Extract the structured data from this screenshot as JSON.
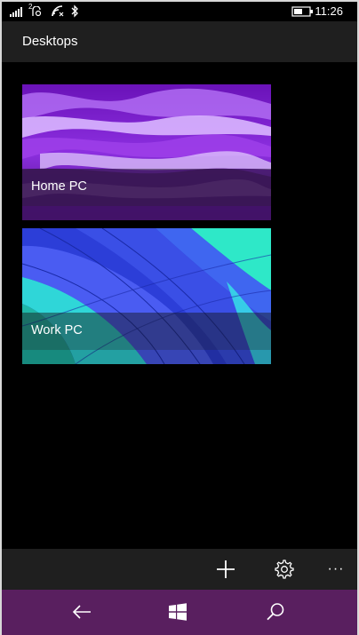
{
  "status_bar": {
    "time": "11:26",
    "sim_badge": "2",
    "icons": [
      "signal-icon",
      "sim2-icon",
      "wifi-icon",
      "bluetooth-icon",
      "battery-icon"
    ]
  },
  "header": {
    "title": "Desktops"
  },
  "desktops": [
    {
      "label": "Home PC",
      "wallpaper": "purple-waves"
    },
    {
      "label": "Work PC",
      "wallpaper": "blue-balloon"
    }
  ],
  "app_bar": {
    "buttons": [
      "add-icon",
      "settings-icon",
      "more-icon"
    ],
    "more_glyph": "···"
  },
  "nav_bar": {
    "buttons": [
      "back-icon",
      "windows-start-icon",
      "search-icon"
    ]
  },
  "colors": {
    "nav_bar": "#591f5f",
    "header": "#1f1f1f",
    "background": "#000000"
  }
}
